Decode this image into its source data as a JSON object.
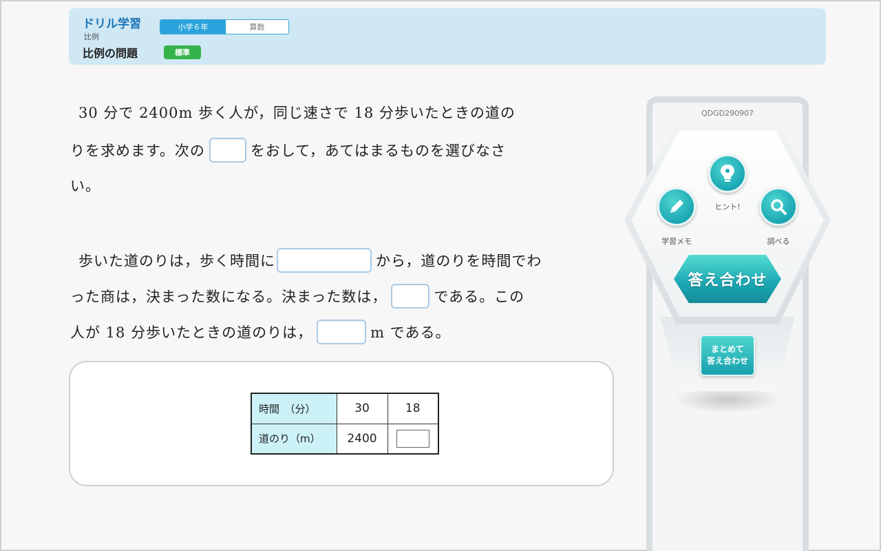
{
  "header": {
    "title": "ドリル学習",
    "grade": "小学６年",
    "subject": "算数",
    "unit": "比例",
    "problem_title": "比例の問題",
    "level": "標準"
  },
  "question": {
    "line1": "30 分で 2400m 歩く人が，同じ速さで 18 分歩いたときの道の",
    "line2a": "りを求めます。次の",
    "line2b": "をおして，あてはまるものを選びなさ",
    "line3": "い。",
    "line4a": "歩いた道のりは，歩く時間に",
    "line4b": "から，道のりを時間でわ",
    "line5a": "った商は，決まった数になる。決まった数は，",
    "line5b": "である。この",
    "line6a": "人が 18 分歩いたときの道のりは，",
    "line6b": "m である。"
  },
  "table": {
    "row1_header": "時間　（分）",
    "row1_values": [
      "30",
      "18"
    ],
    "row2_header": "道のり（m）",
    "row2_value": "2400"
  },
  "side": {
    "code": "QDGD290907",
    "hint_label": "ヒント!",
    "memo_label": "学習メモ",
    "search_label": "調べる",
    "check_label": "答え合わせ",
    "batch_check_line1": "まとめて",
    "batch_check_line2": "答え合わせ"
  },
  "colors": {
    "accent": "#2aa3dc",
    "teal": "#1aa7b4",
    "level_green": "#35b24a",
    "table_header": "#ccf2f7"
  },
  "icons": {
    "hint": "lightbulb-icon",
    "memo": "pencil-icon",
    "search": "magnifier-icon"
  }
}
